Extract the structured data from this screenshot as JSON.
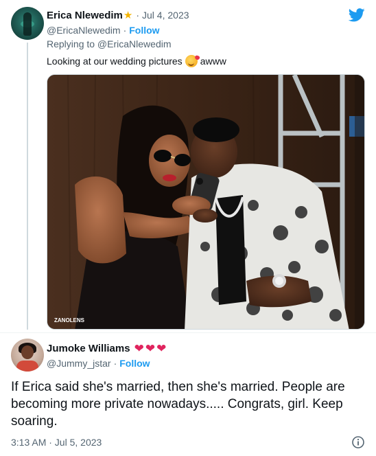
{
  "parent_tweet": {
    "display_name": "Erica Nlewedim",
    "name_badge": "star-icon",
    "separator": "·",
    "date": "Jul 4, 2023",
    "handle": "@EricaNlewedim",
    "handle_separator": "·",
    "follow_label": "Follow",
    "replying_to": "Replying to @EricaNlewedim",
    "text_before_emoji": "Looking at our wedding pictures",
    "emoji": "smiling-face-with-hearts",
    "text_after_emoji": "awww",
    "photo": {
      "watermark": "ZANOLENS",
      "description_icon": "wedding-photo"
    }
  },
  "reply_tweet": {
    "display_name": "Jumoke Williams",
    "name_emojis": [
      "heart-icon",
      "heart-icon",
      "heart-icon"
    ],
    "handle": "@Jummy_jstar",
    "handle_separator": "·",
    "follow_label": "Follow",
    "text": "If Erica said she's married, then she's married. People are becoming more private nowadays..... Congrats, girl. Keep soaring.",
    "timestamp": "3:13 AM · Jul 5, 2023"
  },
  "colors": {
    "accent": "#1d9bf0",
    "secondary_text": "#536471",
    "primary_text": "#0f1419",
    "heart": "#e0245e",
    "star": "#f5b400"
  },
  "icons": {
    "brand": "twitter-bird-icon",
    "info": "info-icon"
  }
}
